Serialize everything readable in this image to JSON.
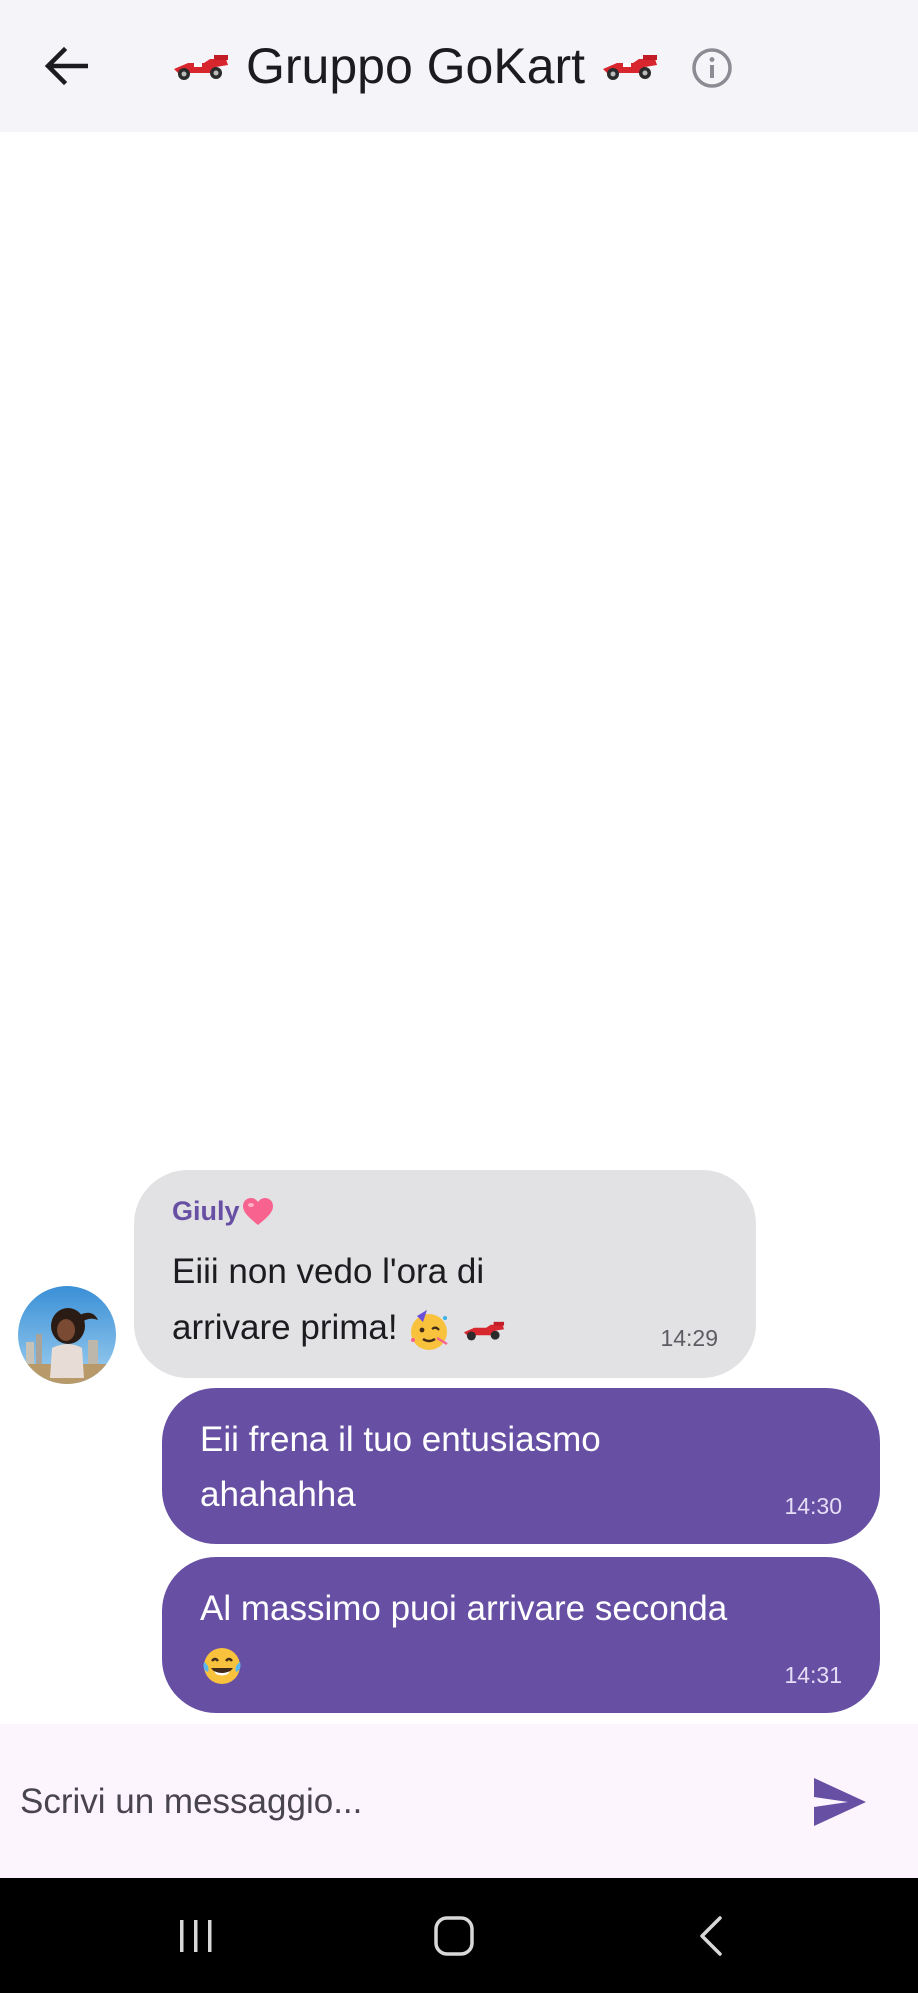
{
  "header": {
    "title": "Gruppo GoKart",
    "back_icon": "arrow-left-icon",
    "info_icon": "info-circle-icon",
    "title_emoji": "racing-car-icon"
  },
  "messages": [
    {
      "direction": "incoming",
      "sender": "Giuly",
      "sender_emoji": "pink-heart-icon",
      "text": "Eiii non vedo l'ora di arrivare prima!",
      "emojis": [
        "partying-face-icon",
        "racing-car-icon"
      ],
      "time": "14:29"
    },
    {
      "direction": "outgoing",
      "text": "Eii frena il tuo entusiasmo ahahahha",
      "time": "14:30"
    },
    {
      "direction": "outgoing",
      "text": "Al massimo puoi arrivare seconda",
      "emojis": [
        "laughing-tears-icon"
      ],
      "time": "14:31"
    }
  ],
  "composer": {
    "placeholder": "Scrivi un messaggio...",
    "send_icon": "send-icon"
  },
  "system_nav": {
    "recents_icon": "recents-icon",
    "home_icon": "home-icon",
    "back_icon": "nav-back-icon"
  },
  "colors": {
    "app_bar": "#f5f4f9",
    "incoming_bubble": "#e2e1e3",
    "outgoing_bubble": "#6750a4",
    "accent": "#6750a4",
    "composer": "#fcf5fd"
  }
}
